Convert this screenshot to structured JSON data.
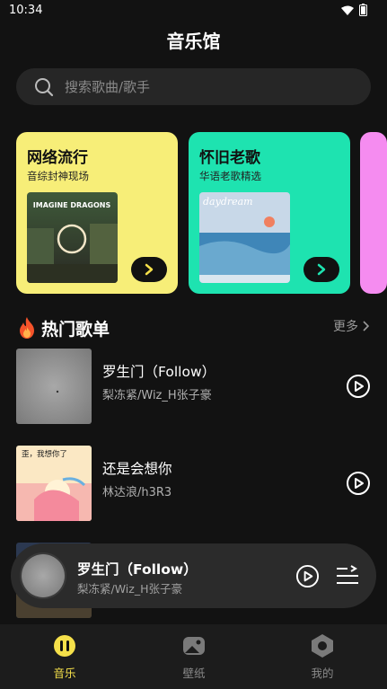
{
  "status": {
    "time": "10:34"
  },
  "title": "音乐馆",
  "search": {
    "placeholder": "搜索歌曲/歌手"
  },
  "cards": [
    {
      "title": "网络流行",
      "subtitle": "音综封神现场",
      "color": "#F7EE78",
      "cover_text": "IMAGINE DRAGONS"
    },
    {
      "title": "怀旧老歌",
      "subtitle": "华语老歌精选",
      "color": "#1EE3B0",
      "cover_text": "daydream"
    }
  ],
  "section": {
    "title": "热门歌单",
    "more": "更多"
  },
  "songs": [
    {
      "title": "罗生门（Follow）",
      "artist": "梨冻紧/Wiz_H张子豪"
    },
    {
      "title": "还是会想你",
      "artist": "林达浪/h3R3",
      "cover_text": "歪，我想你了"
    }
  ],
  "player": {
    "title": "罗生门（Follow）",
    "artist": "梨冻紧/Wiz_H张子豪"
  },
  "tabs": [
    {
      "label": "音乐",
      "active": true
    },
    {
      "label": "壁纸",
      "active": false
    },
    {
      "label": "我的",
      "active": false
    }
  ],
  "colors": {
    "accent": "#F5E04A",
    "background": "#121212",
    "inactive": "#8a8a8a"
  }
}
